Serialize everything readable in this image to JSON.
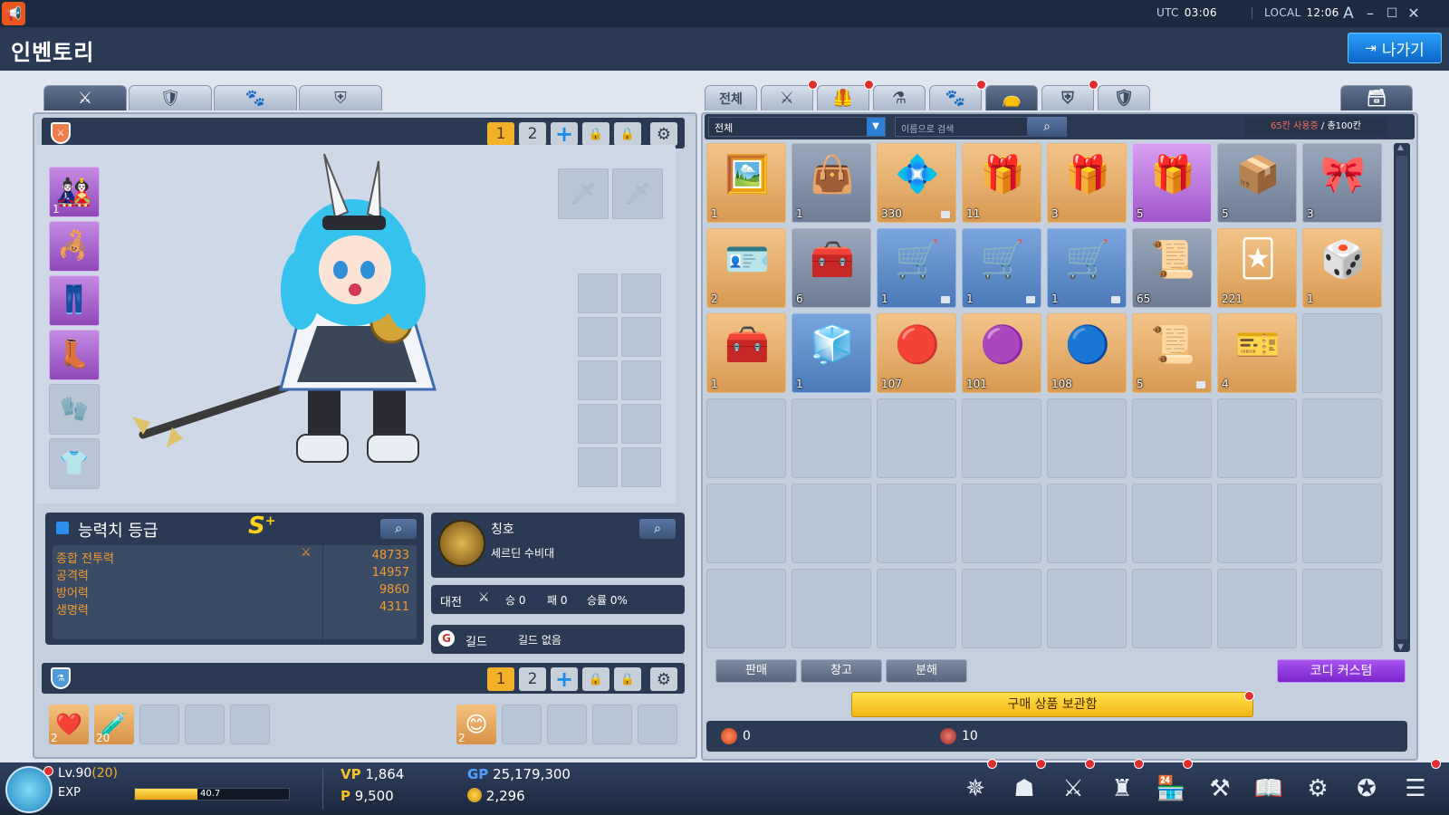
{
  "window": {
    "utc_label": "UTC",
    "utc_time": "03:06",
    "local_label": "LOCAL",
    "local_time": "12:06",
    "font_btn": "A"
  },
  "header": {
    "title": "인벤토리",
    "exit_label": "나가기"
  },
  "equip_tabs": [
    "equip",
    "pet-armor",
    "pet",
    "shield"
  ],
  "presets": {
    "one": "1",
    "two": "2",
    "plus": "+"
  },
  "equipment": {
    "left_slots": [
      {
        "count": "1",
        "filled": true
      },
      {
        "count": "",
        "filled": true
      },
      {
        "count": "",
        "filled": true
      },
      {
        "count": "",
        "filled": true
      },
      {
        "count": "",
        "filled": false
      },
      {
        "count": "",
        "filled": false
      }
    ]
  },
  "stats": {
    "title": "능력치 등급",
    "grade": "S",
    "grade_plus": "+",
    "rows": [
      {
        "label": "종합 전투력",
        "value": "48733"
      },
      {
        "label": "공격력",
        "value": "14957"
      },
      {
        "label": "방어력",
        "value": "9860"
      },
      {
        "label": "생명력",
        "value": "4311"
      }
    ]
  },
  "title_box": {
    "label": "칭호",
    "value": "세르딘 수비대"
  },
  "pvp": {
    "label": "대전",
    "wins": "승 0",
    "losses": "패 0",
    "rate": "승률 0%"
  },
  "guild": {
    "label": "길드",
    "value": "길드 없음"
  },
  "quickslots": {
    "left": [
      {
        "count": "2",
        "filled": true
      },
      {
        "count": "20",
        "filled": true
      },
      {
        "count": "",
        "filled": false
      },
      {
        "count": "",
        "filled": false
      },
      {
        "count": "",
        "filled": false
      }
    ],
    "right": [
      {
        "count": "2",
        "filled": true
      },
      {
        "count": "",
        "filled": false
      },
      {
        "count": "",
        "filled": false
      },
      {
        "count": "",
        "filled": false
      },
      {
        "count": "",
        "filled": false
      }
    ]
  },
  "inventory": {
    "tabs": [
      "전체",
      "equip",
      "armor",
      "potion",
      "pet",
      "bag",
      "shield",
      "pet-armor"
    ],
    "filter_value": "전체",
    "search_placeholder": "이름으로 검색",
    "capacity_used": "65칸 사용중",
    "capacity_total": " / 총100칸",
    "items": [
      {
        "count": "1",
        "color": "orange",
        "icon": "portrait-scroll-icon",
        "glyph": "🖼️",
        "locked": false
      },
      {
        "count": "1",
        "color": "gray",
        "icon": "purple-bag-icon",
        "glyph": "👜",
        "locked": false
      },
      {
        "count": "330",
        "color": "orange",
        "icon": "purple-gem-icon",
        "glyph": "💠",
        "locked": true
      },
      {
        "count": "11",
        "color": "orange",
        "icon": "gold-box-icon",
        "glyph": "🎁",
        "locked": false
      },
      {
        "count": "3",
        "color": "orange",
        "icon": "gold-box-icon",
        "glyph": "🎁",
        "locked": false
      },
      {
        "count": "5",
        "color": "purple",
        "icon": "gold-box-icon",
        "glyph": "🎁",
        "locked": false
      },
      {
        "count": "5",
        "color": "gray",
        "icon": "winged-box-icon",
        "glyph": "📦",
        "locked": false
      },
      {
        "count": "3",
        "color": "gray",
        "icon": "gg-box-icon",
        "glyph": "🎀",
        "locked": false
      },
      {
        "count": "2",
        "color": "orange",
        "icon": "name-card-icon",
        "glyph": "🪪",
        "locked": false
      },
      {
        "count": "6",
        "color": "gray",
        "icon": "treasure-chest-icon",
        "glyph": "🧰",
        "locked": false
      },
      {
        "count": "1",
        "color": "blue",
        "icon": "gift-cart-icon",
        "glyph": "🛒",
        "locked": true
      },
      {
        "count": "1",
        "color": "blue",
        "icon": "gift-cart-icon",
        "glyph": "🛒",
        "locked": true
      },
      {
        "count": "1",
        "color": "blue",
        "icon": "gift-cart-icon",
        "glyph": "🛒",
        "locked": true
      },
      {
        "count": "65",
        "color": "gray",
        "icon": "plus16-scroll-icon",
        "glyph": "📜",
        "locked": false
      },
      {
        "count": "221",
        "color": "orange",
        "icon": "sp-card-icon",
        "glyph": "🃏",
        "locked": false
      },
      {
        "count": "1",
        "color": "orange",
        "icon": "blue-box-icon",
        "glyph": "🎲",
        "locked": false
      },
      {
        "count": "1",
        "color": "orange",
        "icon": "dice-chest-icon",
        "glyph": "🧰",
        "locked": false
      },
      {
        "count": "1",
        "color": "blue",
        "icon": "cube-icon",
        "glyph": "🧊",
        "locked": false
      },
      {
        "count": "107",
        "color": "orange",
        "icon": "red-orb-icon",
        "glyph": "🔴",
        "locked": false
      },
      {
        "count": "101",
        "color": "orange",
        "icon": "purple-orb-icon",
        "glyph": "🟣",
        "locked": false
      },
      {
        "count": "108",
        "color": "orange",
        "icon": "blue-orb-icon",
        "glyph": "🔵",
        "locked": false
      },
      {
        "count": "5",
        "color": "orange",
        "icon": "scroll-icon",
        "glyph": "📜",
        "locked": true
      },
      {
        "count": "4",
        "color": "orange",
        "icon": "ticket-icon",
        "glyph": "🎫",
        "locked": false
      }
    ],
    "sell_label": "판매",
    "storage_label": "창고",
    "disassemble_label": "분해",
    "codi_label": "코디 커스텀",
    "purchase_label": "구매 상품 보관함",
    "currency_a": "0",
    "currency_b": "10"
  },
  "hud": {
    "level": "Lv.90",
    "level_extra": "(20)",
    "exp_label": "EXP",
    "exp_value": "40.7",
    "exp_percent": 40.7,
    "vp_label": "VP",
    "vp_value": "1,864",
    "p_label": "P",
    "p_value": "9,500",
    "gp_label": "GP",
    "gp_value": "25,179,300",
    "coin_value": "2,296",
    "icons": [
      "compass-icon",
      "character-icon",
      "skill-icon",
      "ranking-icon",
      "shop-icon",
      "hammer-icon",
      "quest-book-icon",
      "settings-gear-icon",
      "event-icon",
      "menu-icon"
    ]
  },
  "colors": {
    "accent_gold": "#f3b12a",
    "stat_orange": "#f39a2c",
    "codi_purple": "#a653f0",
    "exit_blue": "#1a86e8"
  }
}
